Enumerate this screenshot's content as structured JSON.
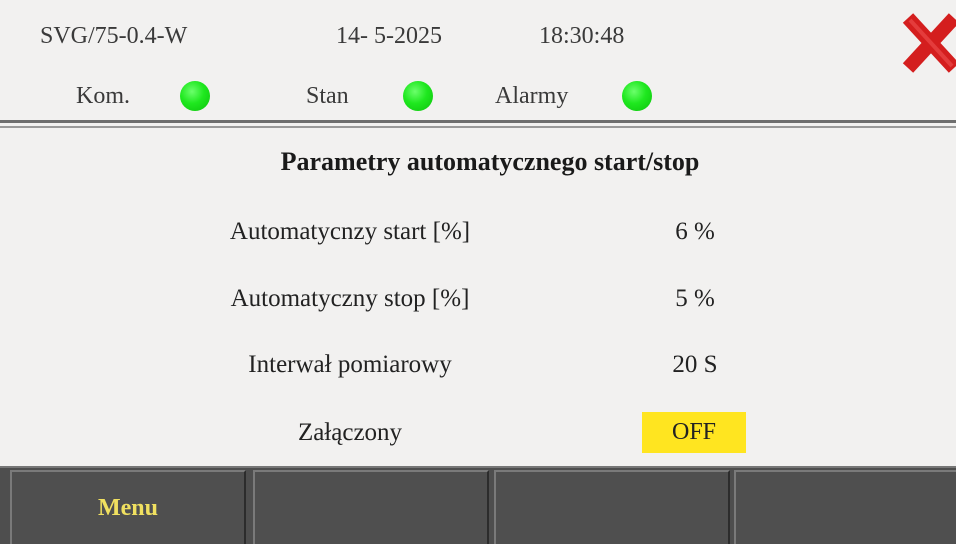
{
  "header": {
    "device_id": "SVG/75-0.4-W",
    "date": "14- 5-2025",
    "time": "18:30:48",
    "indicators": [
      {
        "label": "Kom.",
        "status_color": "#1fe81f"
      },
      {
        "label": "Stan",
        "status_color": "#1fe81f"
      },
      {
        "label": "Alarmy",
        "status_color": "#1fe81f"
      }
    ],
    "close_icon": "close-x-icon",
    "close_color": "#d41e1e"
  },
  "main": {
    "title": "Parametry automatycznego start/stop",
    "params": [
      {
        "label": "Automatycnzy start [%]",
        "value": "6 %"
      },
      {
        "label": "Automatyczny stop [%]",
        "value": "5 %"
      },
      {
        "label": "Interwał pomiarowy",
        "value": "20 S"
      }
    ],
    "enabled": {
      "label": "Załączony",
      "value": "OFF",
      "button_color": "#ffe520"
    }
  },
  "footer": {
    "softkeys": [
      "Menu",
      "",
      "",
      ""
    ],
    "label_color": "#f0e060"
  }
}
